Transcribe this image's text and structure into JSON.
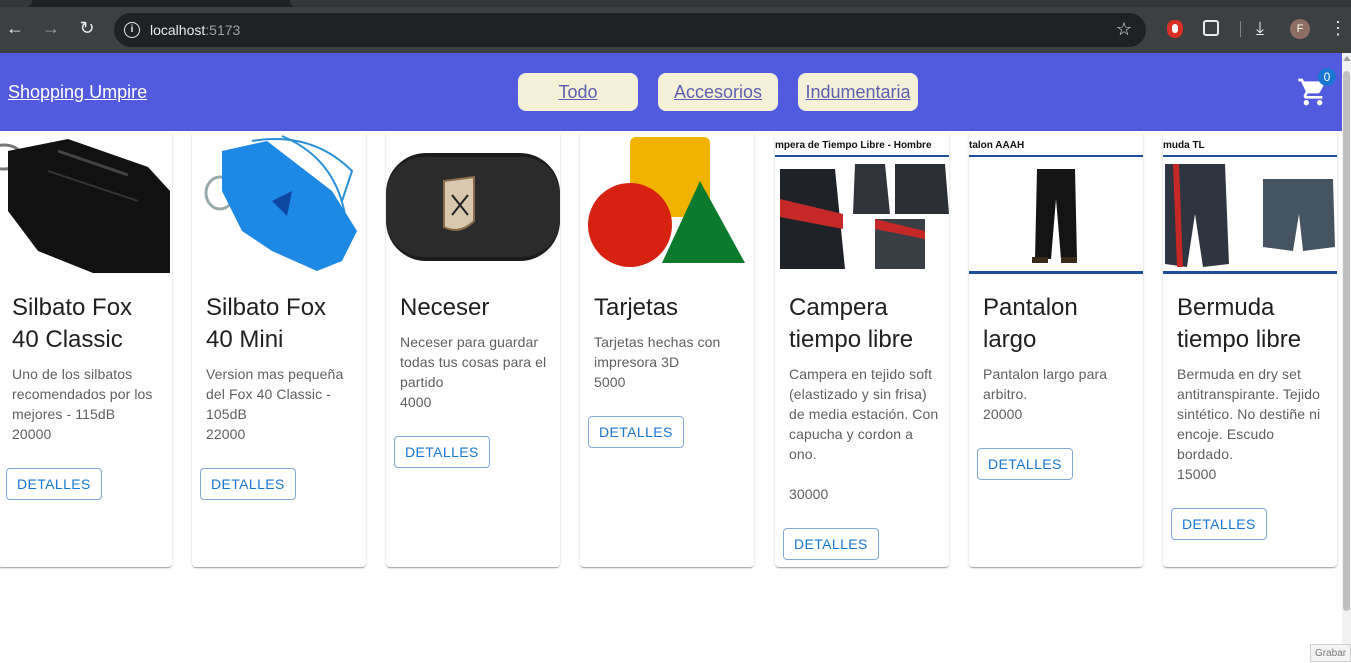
{
  "browser": {
    "url_host": "localhost",
    "url_port": ":5173",
    "profile_initial": "F"
  },
  "navbar": {
    "brand": "Shopping Umpire",
    "links": [
      "Todo",
      "Accesorios",
      "Indumentaria"
    ],
    "cart_count": "0",
    "accent": "#525add"
  },
  "products": [
    {
      "title": "Silbato Fox 40 Classic",
      "description": "Uno de los silbatos recomendados por los mejores - 115dB",
      "price": "20000",
      "button": "DETALLES"
    },
    {
      "title": "Silbato Fox 40 Mini",
      "description": "Version mas pequeña del Fox 40 Classic - 105dB",
      "price": "22000",
      "button": "DETALLES"
    },
    {
      "title": "Neceser",
      "description": "Neceser para guardar todas tus cosas para el partido",
      "price": "4000",
      "button": "DETALLES"
    },
    {
      "title": "Tarjetas",
      "description": "Tarjetas hechas con impresora 3D",
      "price": "5000",
      "button": "DETALLES"
    },
    {
      "title": "Campera tiempo libre",
      "image_caption": "mpera de Tiempo Libre - Hombre",
      "description": "Campera en tejido soft (elastizado y sin frisa) de media estación. Con capucha y cordon a ono.",
      "price": "30000",
      "button": "DETALLES"
    },
    {
      "title": "Pantalon largo",
      "image_caption": "talon AAAH",
      "description": "Pantalon largo para arbitro.",
      "price": "20000",
      "button": "DETALLES"
    },
    {
      "title": "Bermuda tiempo libre",
      "image_caption": "muda TL",
      "description": "Bermuda en dry set antitranspirante. Tejido sintético. No destiñe ni encoje. Escudo bordado.",
      "price": "15000",
      "button": "DETALLES"
    }
  ],
  "recorder_label": "Grabar"
}
